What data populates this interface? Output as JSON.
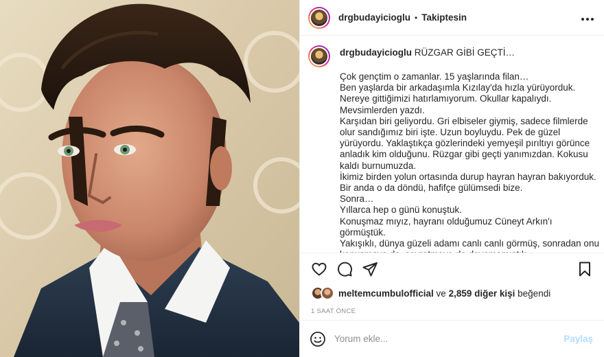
{
  "post": {
    "username": "drgbudayicioglu",
    "dot": "•",
    "follow_status": "Takiptesin",
    "more_icon": "more-horizontal-icon"
  },
  "caption": {
    "username": "drgbudayicioglu",
    "title": "RÜZGAR GİBİ GEÇTİ…",
    "lines": [
      "Çok gençtim o zamanlar. 15 yaşlarında filan…",
      "Ben yaşlarda bir arkadaşımla Kızılay'da hızla yürüyorduk.",
      "Nereye gittiğimizi hatırlamıyorum. Okullar kapalıydı.",
      "Mevsimlerden yazdı.",
      "Karşıdan biri geliyordu. Gri elbiseler giymiş, sadece filmlerde",
      "olur sandığımız biri işte. Uzun boyluydu. Pek de güzel",
      "yürüyordu. Yaklaştıkça gözlerindeki yemyeşil pırıltıyı görünce",
      "anladık kim olduğunu. Rüzgar gibi geçti yanımızdan. Kokusu",
      "kaldı burnumuzda.",
      "İkimiz birden yolun ortasında durup hayran hayran bakıyorduk.",
      "Bir anda o da döndü, hafifçe gülümsedi bize.",
      "Sonra…",
      "Yıllarca hep o günü konuştuk.",
      "Konuşmaz mıyız, hayranı olduğumuz Cüneyt Arkın'ı",
      "görmüştük.",
      "Yakışıklı, dünya güzeli adamı canlı canlı görmüş, sonradan onu",
      "konuşmaya da, seyretmeye de doyamamıştık."
    ]
  },
  "actions": {
    "like_icon": "heart-icon",
    "comment_icon": "comment-icon",
    "share_icon": "send-icon",
    "save_icon": "bookmark-icon"
  },
  "likes": {
    "liker": "meltemcumbulofficial",
    "connector": "ve",
    "others": "2,859 diğer kişi",
    "suffix": "beğendi"
  },
  "timestamp": "1 SAAT ÖNCE",
  "comment_box": {
    "emoji_icon": "emoji-icon",
    "placeholder": "Yorum ekle...",
    "submit_label": "Paylaş"
  },
  "colors": {
    "text": "#262626",
    "muted": "#8e8e8e",
    "share_disabled": "#b2dffc",
    "border": "#efefef"
  }
}
